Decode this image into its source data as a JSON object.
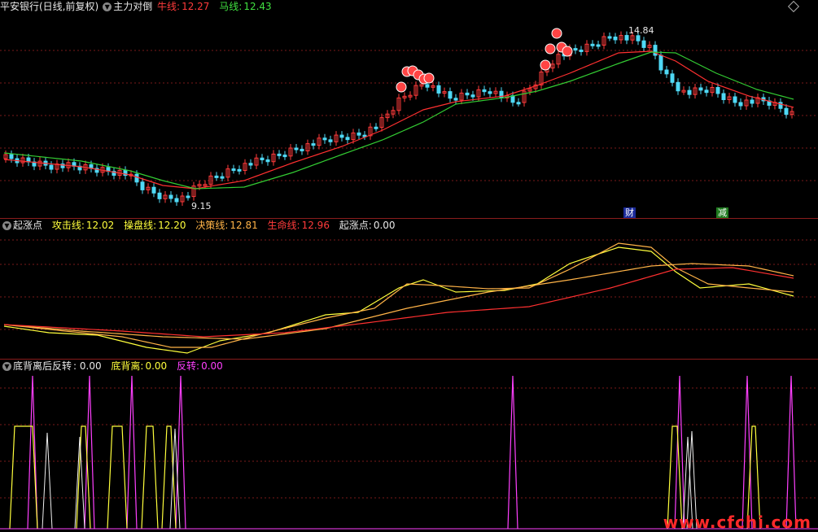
{
  "panel1": {
    "stock": "平安银行(日线,前复权)",
    "indicator": "主力对倒",
    "niu_label": "牛线:",
    "niu_value": "12.27",
    "ma_label": "马线:",
    "ma_value": "12.43",
    "high_label": "14.84",
    "low_label": "9.15",
    "tag_cai": "财",
    "tag_jian": "减"
  },
  "panel2": {
    "name": "起涨点",
    "gongji_label": "攻击线:",
    "gongji_value": "12.02",
    "caopan_label": "操盘线:",
    "caopan_value": "12.20",
    "juece_label": "决策线:",
    "juece_value": "12.81",
    "shengming_label": "生命线:",
    "shengming_value": "12.96",
    "qizhang_label": "起涨点:",
    "qizhang_value": "0.00"
  },
  "panel3": {
    "name": "底背离后反转",
    "name_value": ": 0.00",
    "dibeili_label": "底背离:",
    "dibeili_value": "0.00",
    "fanzhuan_label": "反转:",
    "fanzhuan_value": "0.00"
  },
  "watermark": "www.cfchi.com",
  "colors": {
    "bg": "#000000",
    "up": "#ff3b3b",
    "down": "#4fd9f5",
    "ma_fast": "#ff3030",
    "ma_slow": "#33cc33",
    "line_yellow": "#ffff3c",
    "line_orange": "#ffb347",
    "line_red": "#ff3030",
    "spike_magenta": "#ff40ff",
    "spike_yellow": "#ffff3c"
  }
}
